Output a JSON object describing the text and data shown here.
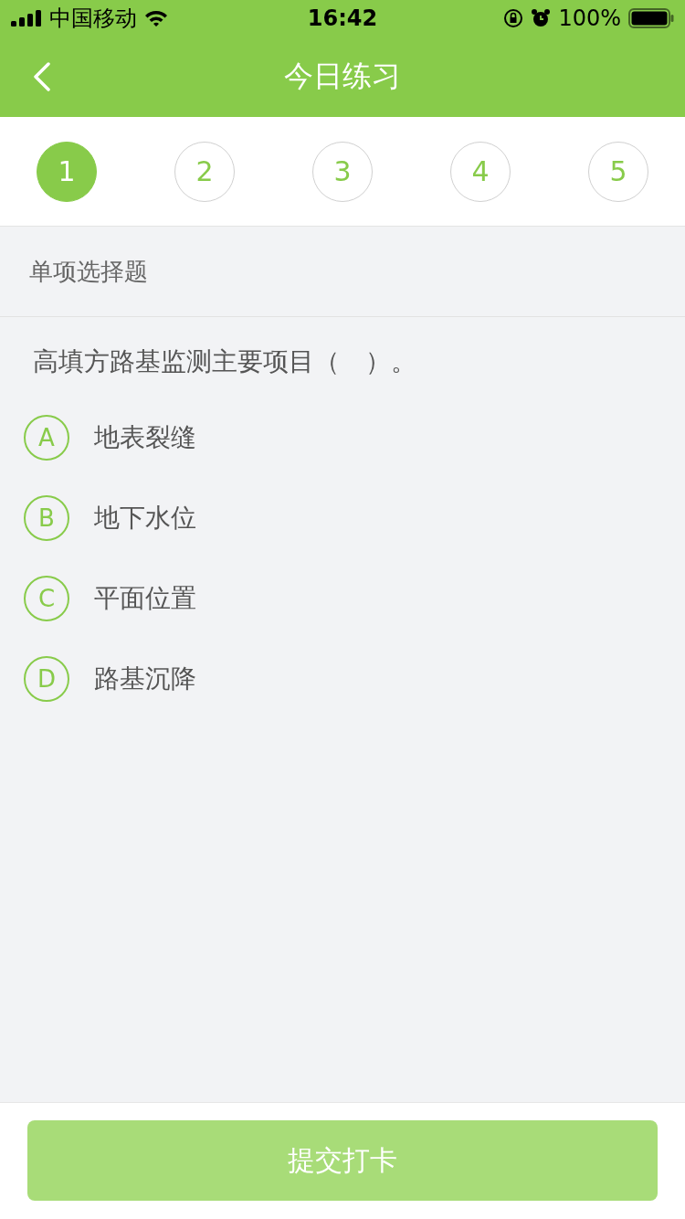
{
  "status_bar": {
    "carrier": "中国移动",
    "time": "16:42",
    "battery": "100%"
  },
  "nav": {
    "title": "今日练习"
  },
  "steps": [
    {
      "label": "1",
      "selected": true
    },
    {
      "label": "2",
      "selected": false
    },
    {
      "label": "3",
      "selected": false
    },
    {
      "label": "4",
      "selected": false
    },
    {
      "label": "5",
      "selected": false
    }
  ],
  "section": {
    "title": "单项选择题"
  },
  "question": {
    "text": "高填方路基监测主要项目（　）。"
  },
  "options": [
    {
      "letter": "A",
      "text": "地表裂缝",
      "selected": false
    },
    {
      "letter": "B",
      "text": "地下水位",
      "selected": false
    },
    {
      "letter": "C",
      "text": "平面位置",
      "selected": false
    },
    {
      "letter": "D",
      "text": "路基沉降",
      "selected": false
    }
  ],
  "submit": {
    "label": "提交打卡",
    "disabled": true
  }
}
